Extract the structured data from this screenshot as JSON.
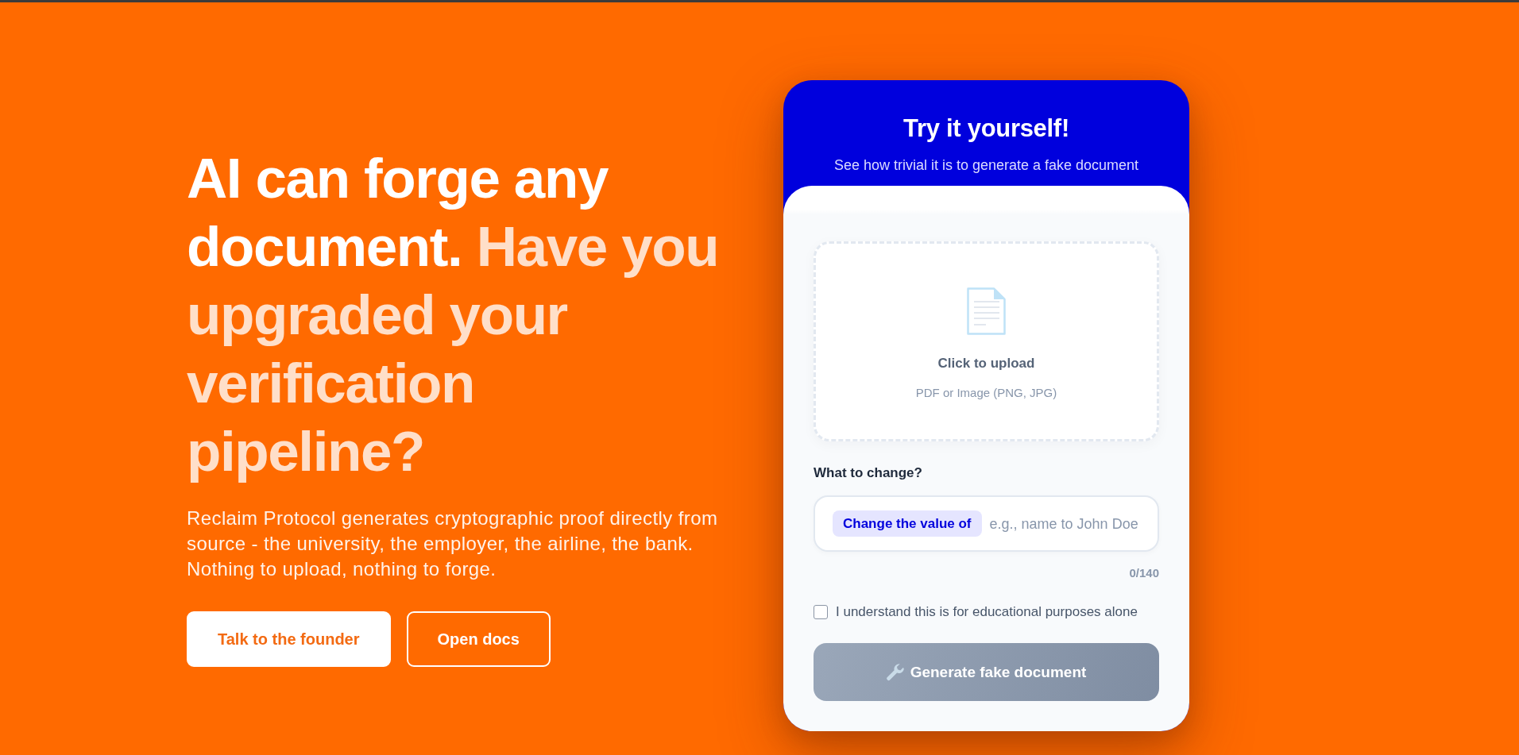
{
  "hero": {
    "heading": [
      {
        "text": "AI can forge any document.",
        "kind": "strong"
      },
      {
        "text": "Have you upgraded your verification pipeline?",
        "kind": "soft"
      }
    ],
    "description": "Reclaim Protocol generates cryptographic proof directly from source - the university, the employer, the airline, the bank. Nothing to upload, nothing to forge.",
    "buttons": [
      {
        "label": "Talk to the founder",
        "kind": "primary"
      },
      {
        "label": "Open docs",
        "kind": "outline"
      }
    ]
  },
  "demo_card": {
    "title": "Try it yourself!",
    "subtitle": "See how trivial it is to generate a fake document",
    "upload": {
      "label": "Click to upload",
      "hint": "PDF or Image (PNG, JPG)"
    },
    "change_field": {
      "label": "What to change?",
      "prefix": "Change the value of",
      "placeholder": "e.g., name to John Doe",
      "counter": "0/140"
    },
    "consent": {
      "label": "I understand this is for educational purposes alone",
      "checked": false
    },
    "generate_button": {
      "label": "Generate fake document",
      "disabled": true
    }
  }
}
